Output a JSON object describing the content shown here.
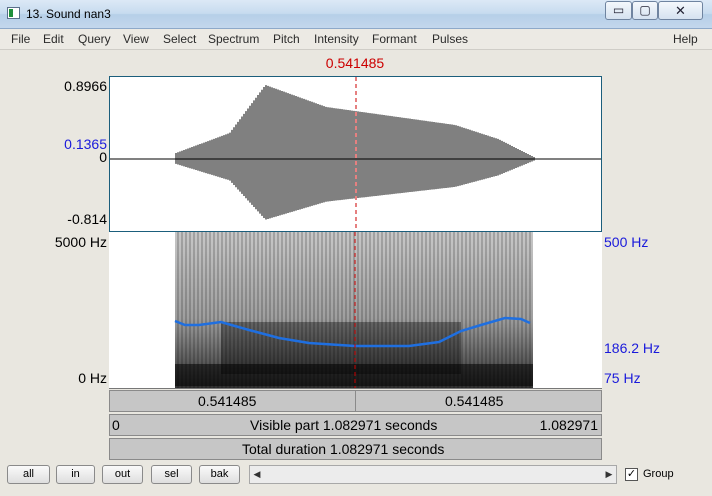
{
  "window": {
    "title": "13. Sound nan3",
    "controls": {
      "minimize": "▭",
      "maximize": "▢",
      "close": "✕"
    }
  },
  "menu": [
    "File",
    "Edit",
    "Query",
    "View",
    "Select",
    "Spectrum",
    "Pitch",
    "Intensity",
    "Formant",
    "Pulses",
    "Help"
  ],
  "editor": {
    "cursor_time": "0.541485",
    "waveform": {
      "max_label": "0.8966",
      "cursor_value_label": "0.1365",
      "zero_label": "0",
      "min_label": "-0.814"
    },
    "spectrogram": {
      "top_label": "5000 Hz",
      "bottom_label": "0 Hz",
      "pitch_top_label": "500 Hz",
      "pitch_value_label": "186.2 Hz",
      "pitch_bottom_label": "75 Hz"
    },
    "time_segments": {
      "left": "0.541485",
      "right": "0.541485"
    },
    "visible_part": {
      "start": "0",
      "label": "Visible part 1.082971 seconds",
      "end": "1.082971"
    },
    "total_duration": "Total duration 1.082971 seconds"
  },
  "buttons": {
    "all": "all",
    "in": "in",
    "out": "out",
    "sel": "sel",
    "bak": "bak"
  },
  "scroll": {
    "left_arrow": "◀",
    "right_arrow": "▶"
  },
  "group": {
    "label": "Group",
    "checked": true,
    "check_glyph": "✓"
  },
  "colors": {
    "cursor": "#cc0000",
    "pitch_curve": "#1f6fe0",
    "axis_blue": "#1a1adb"
  }
}
